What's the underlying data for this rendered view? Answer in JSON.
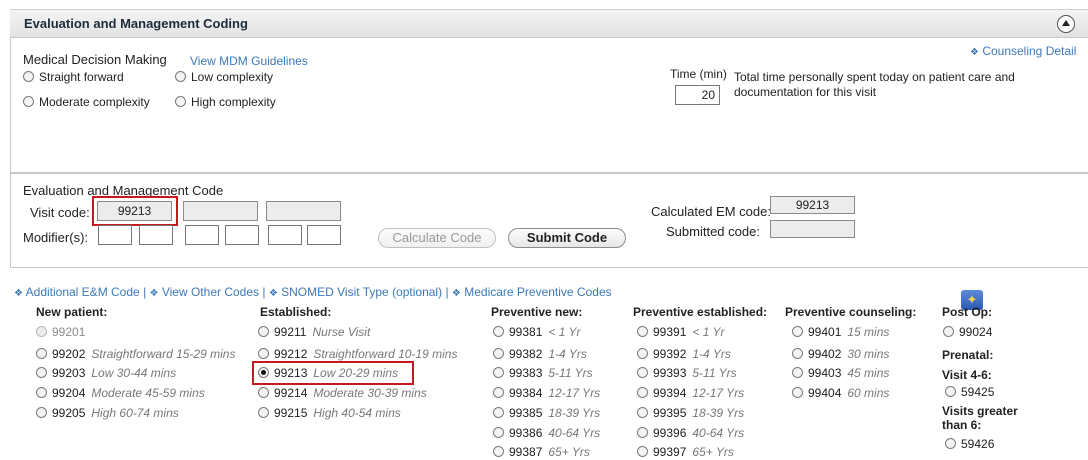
{
  "header": {
    "title": "Evaluation and Management Coding"
  },
  "mdm": {
    "title": "Medical Decision Making",
    "guidelines_link": "View MDM Guidelines",
    "options": [
      "Straight forward",
      "Low complexity",
      "Moderate complexity",
      "High complexity"
    ],
    "counseling_link": "Counseling Detail",
    "time_label": "Time (min)",
    "time_value": "20",
    "time_desc_line1": "Total time personally spent today on patient care and",
    "time_desc_line2": "documentation for this visit"
  },
  "em": {
    "title": "Evaluation and Management Code",
    "visit_code_label": "Visit code:",
    "visit_code_value": "99213",
    "modifier_label": "Modifier(s):",
    "calc_label": "Calculated EM code:",
    "calc_value": "99213",
    "submitted_label": "Submitted code:",
    "submitted_value": "",
    "calculate_btn": "Calculate Code",
    "submit_btn": "Submit Code"
  },
  "links": {
    "additional": "Additional E&M Code",
    "other": "View Other Codes",
    "snomed": "SNOMED Visit Type (optional)",
    "medicare": "Medicare Preventive Codes",
    "sep": "|"
  },
  "codes": {
    "new_patient": {
      "header": "New patient:",
      "items": [
        {
          "code": "99201",
          "desc": "",
          "disabled": true
        },
        {
          "code": "99202",
          "desc": "Straightforward 15-29 mins"
        },
        {
          "code": "99203",
          "desc": "Low 30-44 mins"
        },
        {
          "code": "99204",
          "desc": "Moderate 45-59 mins"
        },
        {
          "code": "99205",
          "desc": "High 60-74 mins"
        }
      ]
    },
    "established": {
      "header": "Established:",
      "items": [
        {
          "code": "99211",
          "desc": "Nurse Visit"
        },
        {
          "code": "99212",
          "desc": "Straightforward 10-19 mins"
        },
        {
          "code": "99213",
          "desc": "Low 20-29 mins",
          "checked": true
        },
        {
          "code": "99214",
          "desc": "Moderate 30-39 mins"
        },
        {
          "code": "99215",
          "desc": "High 40-54 mins"
        }
      ]
    },
    "preventive_new": {
      "header": "Preventive new:",
      "items": [
        {
          "code": "99381",
          "desc": "< 1 Yr"
        },
        {
          "code": "99382",
          "desc": "1-4 Yrs"
        },
        {
          "code": "99383",
          "desc": "5-11 Yrs"
        },
        {
          "code": "99384",
          "desc": "12-17 Yrs"
        },
        {
          "code": "99385",
          "desc": "18-39 Yrs"
        },
        {
          "code": "99386",
          "desc": "40-64 Yrs"
        },
        {
          "code": "99387",
          "desc": "65+ Yrs"
        }
      ]
    },
    "preventive_established": {
      "header": "Preventive established:",
      "items": [
        {
          "code": "99391",
          "desc": "< 1 Yr"
        },
        {
          "code": "99392",
          "desc": "1-4 Yrs"
        },
        {
          "code": "99393",
          "desc": "5-11 Yrs"
        },
        {
          "code": "99394",
          "desc": "12-17 Yrs"
        },
        {
          "code": "99395",
          "desc": "18-39 Yrs"
        },
        {
          "code": "99396",
          "desc": "40-64 Yrs"
        },
        {
          "code": "99397",
          "desc": "65+ Yrs"
        }
      ]
    },
    "preventive_counseling": {
      "header": "Preventive counseling:",
      "items": [
        {
          "code": "99401",
          "desc": "15 mins"
        },
        {
          "code": "99402",
          "desc": "30 mins"
        },
        {
          "code": "99403",
          "desc": "45 mins"
        },
        {
          "code": "99404",
          "desc": "60 mins"
        }
      ]
    },
    "post_op": {
      "header": "Post Op:",
      "code": "99024"
    },
    "prenatal": {
      "header": "Prenatal:",
      "visit_label": "Visit 4-6:",
      "visit_code": "59425",
      "greater_label_1": "Visits greater",
      "greater_label_2": "than 6:",
      "greater_code": "59426"
    }
  }
}
